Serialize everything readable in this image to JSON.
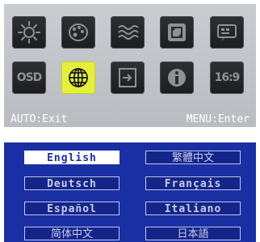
{
  "menu": {
    "row1": [
      {
        "icon": "brightness-sun-icon"
      },
      {
        "icon": "color-palette-icon"
      },
      {
        "icon": "wave-image-icon"
      },
      {
        "icon": "position-icon"
      },
      {
        "icon": "menu-settings-icon"
      }
    ],
    "row2": [
      {
        "icon": "osd-icon",
        "label": "OSD"
      },
      {
        "icon": "globe-language-icon",
        "selected": true
      },
      {
        "icon": "input-source-icon"
      },
      {
        "icon": "info-icon"
      },
      {
        "icon": "aspect-ratio-icon",
        "label": "16:9"
      }
    ],
    "footer": {
      "left": "AUTO:Exit",
      "right": "MENU:Enter"
    }
  },
  "languages": [
    {
      "label": "English",
      "selected": true
    },
    {
      "label": "繁體中文"
    },
    {
      "label": "Deutsch"
    },
    {
      "label": "Français"
    },
    {
      "label": "Español"
    },
    {
      "label": "Italiano"
    },
    {
      "label": "简体中文"
    },
    {
      "label": "日本語"
    }
  ],
  "colors": {
    "selected_tile": "#e6f03a",
    "lang_panel_bg": "#1a2fa4"
  }
}
